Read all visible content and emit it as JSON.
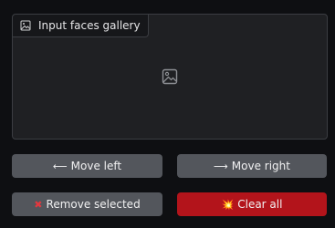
{
  "gallery": {
    "label": "Input faces gallery",
    "label_icon": "image-icon",
    "placeholder_icon": "image-icon"
  },
  "buttons": {
    "move_left": {
      "glyph": "⟵",
      "label": "Move left"
    },
    "move_right": {
      "glyph": "⟶",
      "label": "Move right"
    },
    "remove_selected": {
      "glyph": "✖",
      "label": "Remove selected"
    },
    "clear_all": {
      "glyph": "💥",
      "label": "Clear all"
    }
  },
  "colors": {
    "background": "#0e0f12",
    "panel": "#1f2023",
    "secondary_button": "#53565c",
    "danger_button": "#b3141b"
  }
}
